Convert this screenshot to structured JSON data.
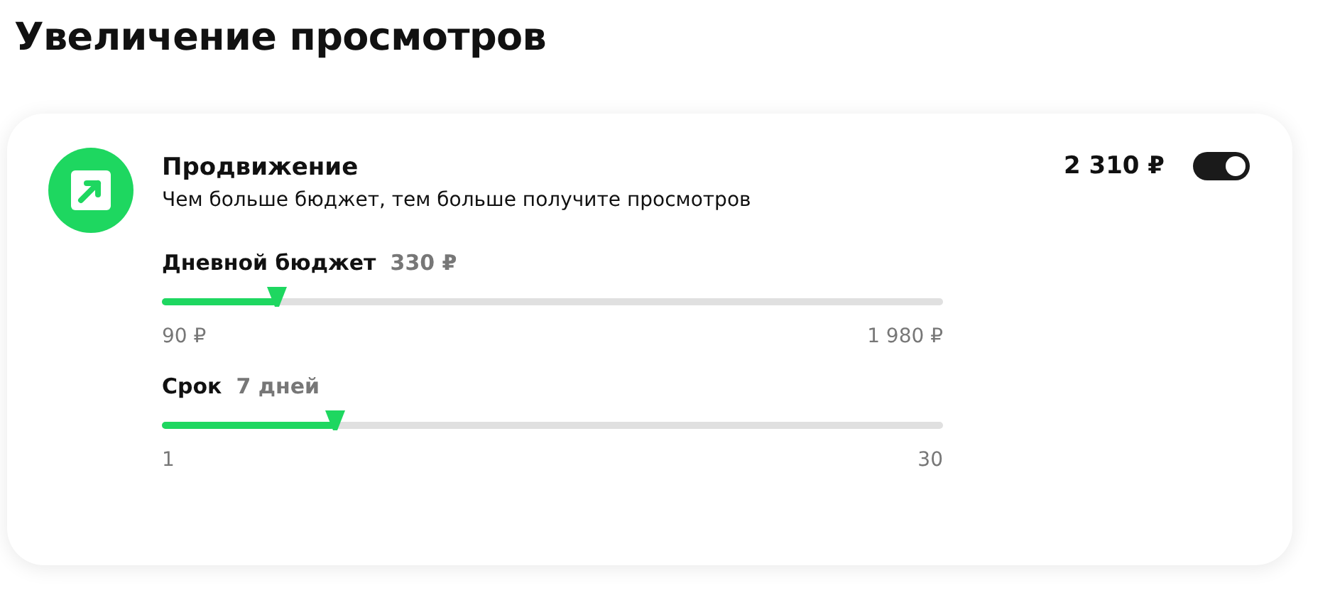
{
  "page_title": "Увеличение просмотров",
  "promo": {
    "title": "Продвижение",
    "subtitle": "Чем больше бюджет, тем больше получите просмотров",
    "price": "2 310 ₽",
    "on": true
  },
  "sliders": [
    {
      "label": "Дневной бюджет",
      "value": "330 ₽",
      "level": 0.148,
      "min": "90 ₽",
      "max": "1 980 ₽"
    },
    {
      "label": "Срок",
      "value": "7 дней",
      "level": 0.222,
      "min": "1",
      "max": "30"
    }
  ]
}
